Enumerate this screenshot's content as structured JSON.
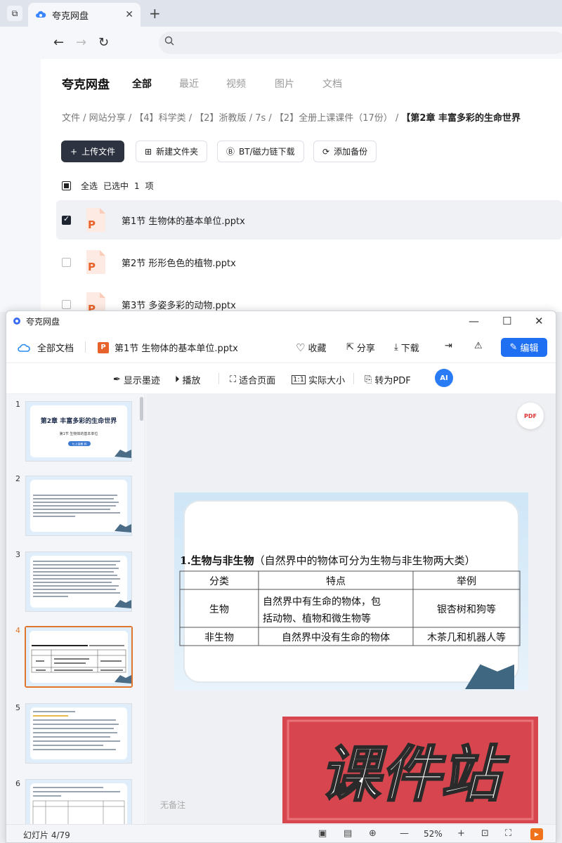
{
  "browser": {
    "tab_title": "夸克网盘"
  },
  "page": {
    "brand": "夸克网盘",
    "top_tabs": [
      "全部",
      "最近",
      "视频",
      "图片",
      "文档"
    ],
    "breadcrumb": [
      "文件",
      "网站分享",
      "【4】科学类",
      "【2】浙教版",
      "7s",
      "【2】全册上课课件（17份）",
      "【第2章 丰富多彩的生命世界"
    ],
    "actions": {
      "upload": "上传文件",
      "new_folder": "新建文件夹",
      "bt_download": "BT/磁力链下载",
      "add_backup": "添加备份"
    },
    "selection": {
      "select_all": "全选",
      "selected_text": "已选中",
      "count": "1",
      "unit": "项"
    },
    "files": [
      {
        "name": "第1节 生物体的基本单位.pptx",
        "selected": true
      },
      {
        "name": "第2节 形形色色的植物.pptx",
        "selected": false
      },
      {
        "name": "第3节 多姿多彩的动物.pptx",
        "selected": false
      }
    ]
  },
  "viewer": {
    "window_title": "夸克网盘",
    "all_docs": "全部文档",
    "file_name": "第1节 生物体的基本单位.pptx",
    "file_badge": "P",
    "favorite": "收藏",
    "share": "分享",
    "download": "下载",
    "edit": "编辑",
    "toolbar2": {
      "ink": "显示墨迹",
      "play": "播放",
      "fit": "适合页面",
      "actual": "实际大小",
      "to_pdf": "转为PDF",
      "ai": "AI"
    },
    "pdf_badge": "PDF",
    "thumb_numbers": [
      "1",
      "2",
      "3",
      "4",
      "5",
      "6"
    ],
    "thumb1": {
      "title": "第2章 丰富多彩的生命世界",
      "subtitle": "第1节 生物体的基本单位",
      "pill": "七上浙教 科"
    },
    "slide": {
      "heading_bold": "1.生物与非生物",
      "heading_rest": "（自然界中的物体可分为生物与非生物两大类）",
      "table_headers": [
        "分类",
        "特点",
        "举例"
      ],
      "rows": [
        {
          "c1": "生物",
          "c2a": "自然界中有生命的物体，包",
          "c2b": "括动物、植物和微生物等",
          "c3": "银杏树和狗等"
        },
        {
          "c1": "非生物",
          "c2a": "自然界中没有生命的物体",
          "c2b": "",
          "c3": "木茶几和机器人等"
        }
      ]
    },
    "notes": "无备注",
    "status": {
      "slide_label": "幻灯片 4/79",
      "zoom": "52%"
    },
    "watermark": "课件站"
  }
}
